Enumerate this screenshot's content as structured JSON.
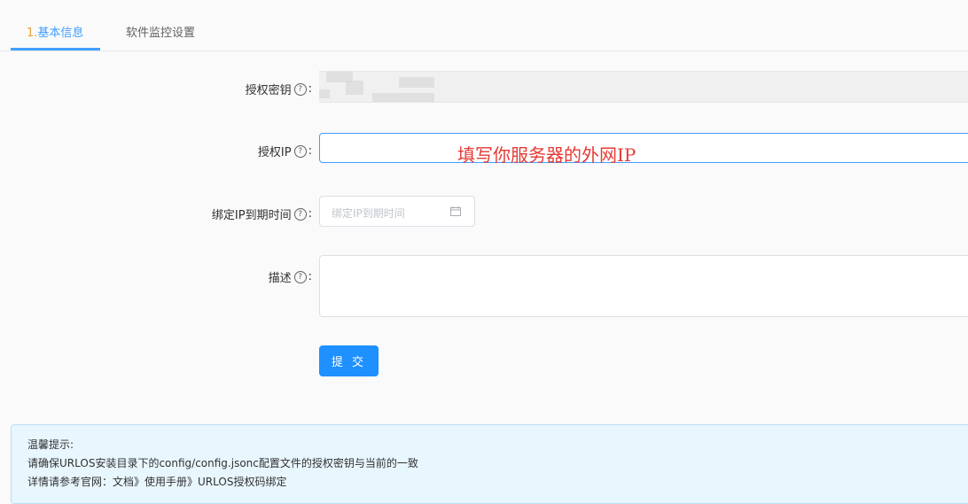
{
  "tabs": [
    {
      "num": "1.",
      "label": "基本信息",
      "active": true
    },
    {
      "label": "软件监控设置",
      "active": false
    }
  ],
  "form": {
    "key": {
      "label": "授权密钥",
      "help": "?",
      "colon": ":"
    },
    "ip": {
      "label": "授权IP",
      "help": "?",
      "colon": ":",
      "value": "",
      "annotation": "填写你服务器的外网IP"
    },
    "expire": {
      "label": "绑定IP到期时间",
      "help": "?",
      "colon": ":",
      "placeholder": "绑定IP到期时间"
    },
    "desc": {
      "label": "描述",
      "help": "?",
      "colon": ":",
      "value": ""
    },
    "submit": "提 交"
  },
  "tip": {
    "title": "温馨提示:",
    "line1": "请确保URLOS安装目录下的config/config.jsonc配置文件的授权密钥与当前的一致",
    "line2": "详情请参考官网：文档》使用手册》URLOS授权码绑定"
  },
  "colors": {
    "accent": "#409eff",
    "primary_button": "#1e90ff",
    "tab_number": "#e6a23c",
    "annotation": "#e53935"
  },
  "icons": {
    "help": "question-circle-icon",
    "calendar": "calendar-icon"
  }
}
